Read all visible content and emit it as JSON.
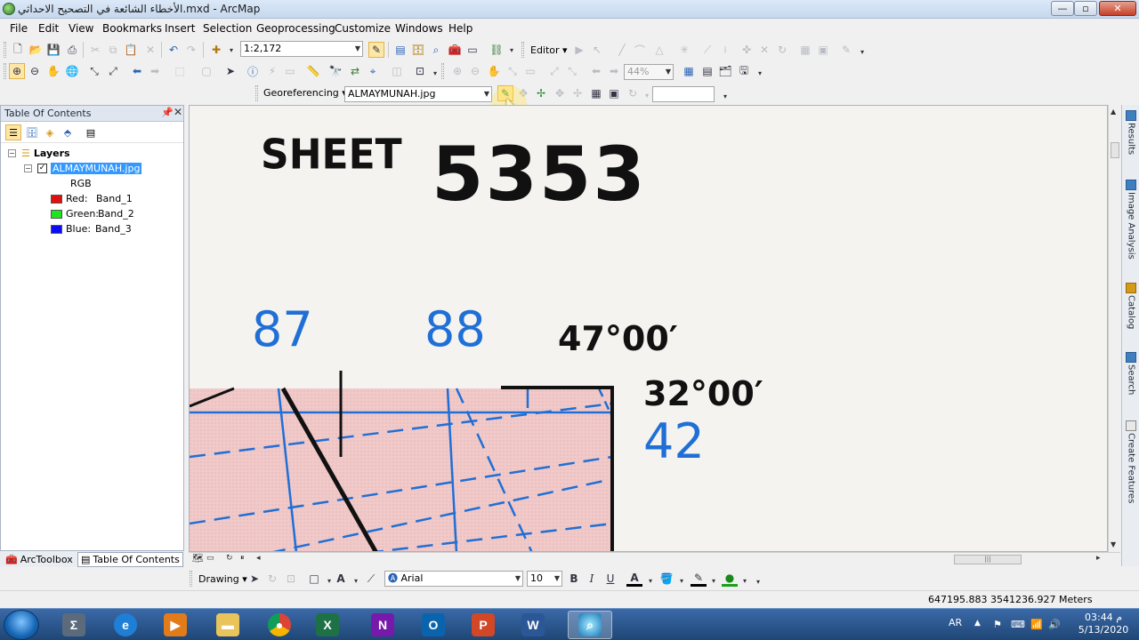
{
  "window": {
    "title": "الأخطاء الشائعة في التصحيح الاحداثي.mxd - ArcMap",
    "min_glyph": "—",
    "max_glyph": "▫",
    "close_glyph": "✕"
  },
  "menu": [
    "File",
    "Edit",
    "View",
    "Bookmarks",
    "Insert",
    "Selection",
    "Geoprocessing",
    "Customize",
    "Windows",
    "Help"
  ],
  "standard_toolbar": {
    "scale": "1:2,172",
    "editor_label": "Editor ▾"
  },
  "tools_toolbar": {
    "zoom_level": "44%"
  },
  "georef_toolbar": {
    "label": "Georeferencing ▾",
    "layer": "ALMAYMUNAH.jpg",
    "transform_value": ""
  },
  "toc": {
    "title": "Table Of Contents",
    "root_label": "Layers",
    "layer_name": "ALMAYMUNAH.jpg",
    "layer_checked": "✓",
    "render_type": "RGB",
    "bands": [
      {
        "channel": "Red:",
        "band": "Band_1",
        "color": "#e01010"
      },
      {
        "channel": "Green:",
        "band": "Band_2",
        "color": "#1ee61e"
      },
      {
        "channel": "Blue:",
        "band": "Band_3",
        "color": "#0b0bf5"
      }
    ],
    "tabs": [
      "ArcToolbox",
      "Table Of Contents"
    ]
  },
  "map": {
    "sheet_label": "SHEET",
    "sheet_number": "5353",
    "grid_left": "87",
    "grid_right": "88",
    "longitude": "47°00′",
    "latitude": "32°00′",
    "grid_row": "42",
    "sheet_fill": "#f2c9c9",
    "grid_color": "#1f6fd6"
  },
  "right_dock": [
    "Results",
    "Image Analysis",
    "Catalog",
    "Search",
    "Create Features"
  ],
  "drawing_toolbar": {
    "label": "Drawing ▾",
    "font": "Arial",
    "size": "10",
    "bold": "B",
    "italic": "I",
    "underline": "U"
  },
  "status": {
    "coordinates": "647195.883  3541236.927 Meters"
  },
  "taskbar": {
    "apps": [
      "Calculator",
      "Internet Explorer",
      "Media Player",
      "File Explorer",
      "Chrome",
      "Excel",
      "OneNote",
      "Outlook",
      "PowerPoint",
      "Word",
      "ArcMap"
    ],
    "language": "AR",
    "time": "03:44 م",
    "date": "5/13/2020"
  }
}
